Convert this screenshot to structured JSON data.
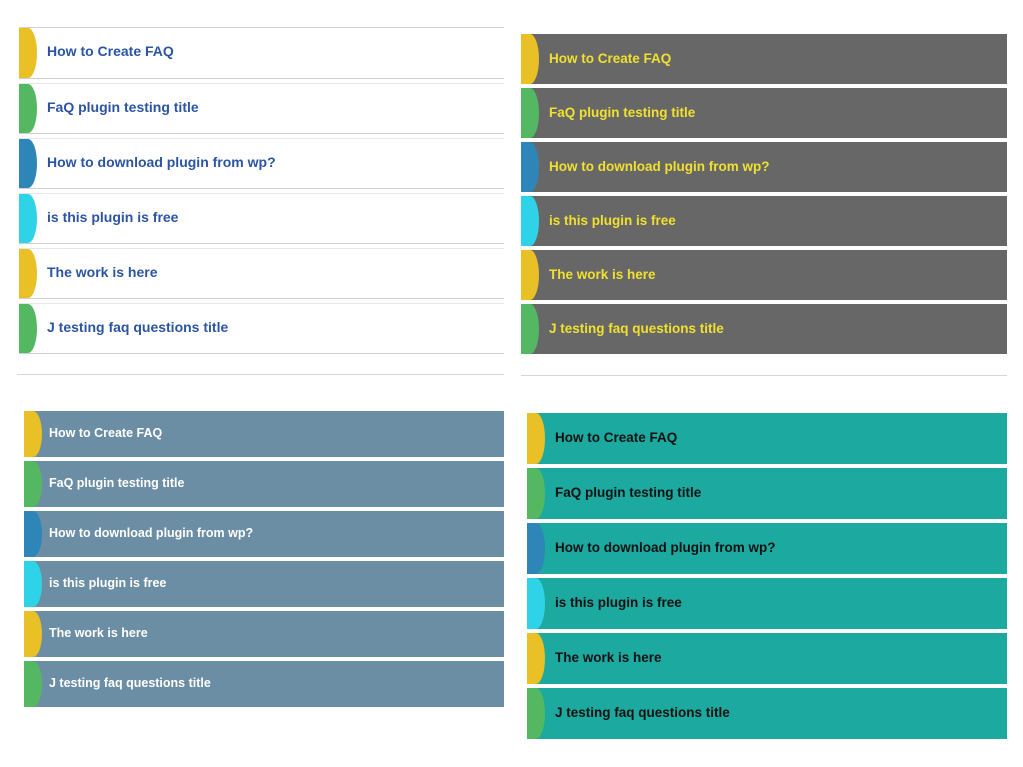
{
  "colors": {
    "tab_yellow": "#e9c026",
    "tab_green": "#53b861",
    "tab_blue": "#2e86b8",
    "tab_cyan": "#2fd3e8"
  },
  "panels": [
    {
      "theme": "white",
      "items": [
        {
          "title": "How to Create FAQ",
          "tab": "tab_yellow"
        },
        {
          "title": "FaQ plugin testing title",
          "tab": "tab_green"
        },
        {
          "title": "How to download plugin from wp?",
          "tab": "tab_blue"
        },
        {
          "title": "is this plugin is free",
          "tab": "tab_cyan"
        },
        {
          "title": "The work is here",
          "tab": "tab_yellow"
        },
        {
          "title": "J testing faq questions title",
          "tab": "tab_green"
        }
      ]
    },
    {
      "theme": "dark-grey",
      "items": [
        {
          "title": "How to Create FAQ",
          "tab": "tab_yellow"
        },
        {
          "title": "FaQ plugin testing title",
          "tab": "tab_green"
        },
        {
          "title": "How to download plugin from wp?",
          "tab": "tab_blue"
        },
        {
          "title": "is this plugin is free",
          "tab": "tab_cyan"
        },
        {
          "title": "The work is here",
          "tab": "tab_yellow"
        },
        {
          "title": "J testing faq questions title",
          "tab": "tab_green"
        }
      ]
    },
    {
      "theme": "slate-blue",
      "items": [
        {
          "title": "How to Create FAQ",
          "tab": "tab_yellow"
        },
        {
          "title": "FaQ plugin testing title",
          "tab": "tab_green"
        },
        {
          "title": "How to download plugin from wp?",
          "tab": "tab_blue"
        },
        {
          "title": "is this plugin is free",
          "tab": "tab_cyan"
        },
        {
          "title": "The work is here",
          "tab": "tab_yellow"
        },
        {
          "title": "J testing faq questions title",
          "tab": "tab_green"
        }
      ]
    },
    {
      "theme": "teal",
      "items": [
        {
          "title": "How to Create FAQ",
          "tab": "tab_yellow"
        },
        {
          "title": "FaQ plugin testing title",
          "tab": "tab_green"
        },
        {
          "title": "How to download plugin from wp?",
          "tab": "tab_blue"
        },
        {
          "title": "is this plugin is free",
          "tab": "tab_cyan"
        },
        {
          "title": "The work is here",
          "tab": "tab_yellow"
        },
        {
          "title": "J testing faq questions title",
          "tab": "tab_green"
        }
      ]
    }
  ]
}
